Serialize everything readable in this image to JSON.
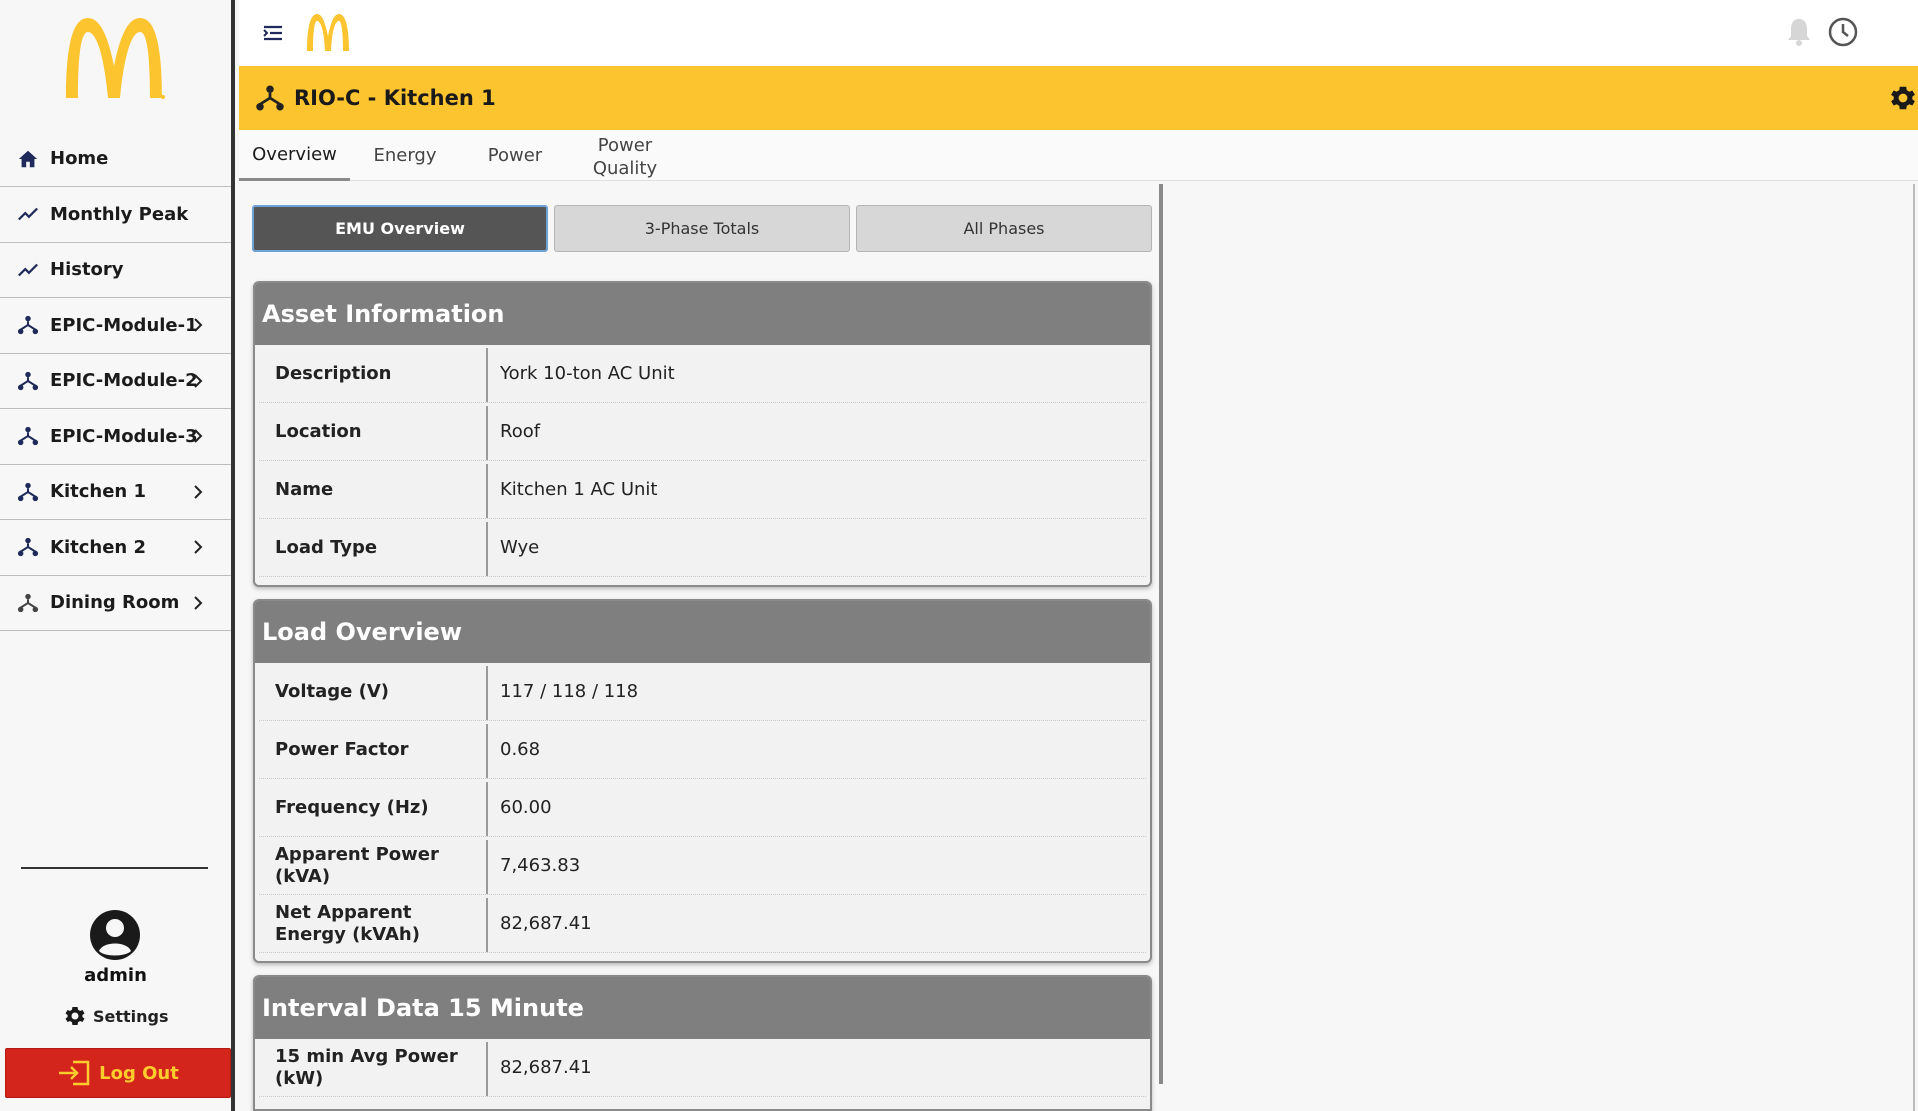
{
  "sidebar": {
    "items": [
      {
        "label": "Home",
        "icon": "home-icon",
        "chevron": false
      },
      {
        "label": "Monthly Peak",
        "icon": "trend-icon",
        "chevron": false
      },
      {
        "label": "History",
        "icon": "trend-icon",
        "chevron": false
      },
      {
        "label": "EPIC-Module-1",
        "icon": "hierarchy-icon",
        "chevron": true
      },
      {
        "label": "EPIC-Module-2",
        "icon": "hierarchy-icon",
        "chevron": true
      },
      {
        "label": "EPIC-Module-3",
        "icon": "hierarchy-icon",
        "chevron": true
      },
      {
        "label": "Kitchen 1",
        "icon": "hierarchy-icon",
        "chevron": true
      },
      {
        "label": "Kitchen 2",
        "icon": "hierarchy-icon",
        "chevron": true
      },
      {
        "label": "Dining Room",
        "icon": "hierarchy-icon",
        "chevron": true
      }
    ],
    "username": "admin",
    "settings_label": "Settings",
    "logout_label": "Log Out"
  },
  "header": {
    "title": "RIO-C - Kitchen 1"
  },
  "tabs": [
    {
      "label": "Overview",
      "active": true
    },
    {
      "label": "Energy",
      "active": false
    },
    {
      "label": "Power",
      "active": false
    },
    {
      "label": "Power Quality",
      "active": false
    }
  ],
  "segments": [
    {
      "label": "EMU Overview",
      "active": true
    },
    {
      "label": "3-Phase Totals",
      "active": false
    },
    {
      "label": "All Phases",
      "active": false
    }
  ],
  "cards": {
    "asset": {
      "title": "Asset Information",
      "rows": [
        {
          "key": "Description",
          "value": "York 10-ton AC Unit"
        },
        {
          "key": "Location",
          "value": "Roof"
        },
        {
          "key": "Name",
          "value": "Kitchen 1 AC Unit"
        },
        {
          "key": "Load Type",
          "value": "Wye"
        }
      ]
    },
    "load": {
      "title": "Load Overview",
      "rows": [
        {
          "key": "Voltage (V)",
          "value": "117 / 118 / 118"
        },
        {
          "key": "Power Factor",
          "value": "0.68"
        },
        {
          "key": "Frequency (Hz)",
          "value": "60.00"
        },
        {
          "key": "Apparent Power (kVA)",
          "value": "7,463.83"
        },
        {
          "key": "Net Apparent Energy (kVAh)",
          "value": "82,687.41"
        }
      ]
    },
    "interval": {
      "title": "Interval Data 15 Minute",
      "rows": [
        {
          "key": "15 min Avg Power (kW)",
          "value": "82,687.41"
        }
      ]
    }
  },
  "colors": {
    "brand_yellow": "#fcc42e",
    "brand_red": "#d4251c",
    "card_header": "#7f7f7f",
    "nav_icon": "#1f2a5a"
  }
}
